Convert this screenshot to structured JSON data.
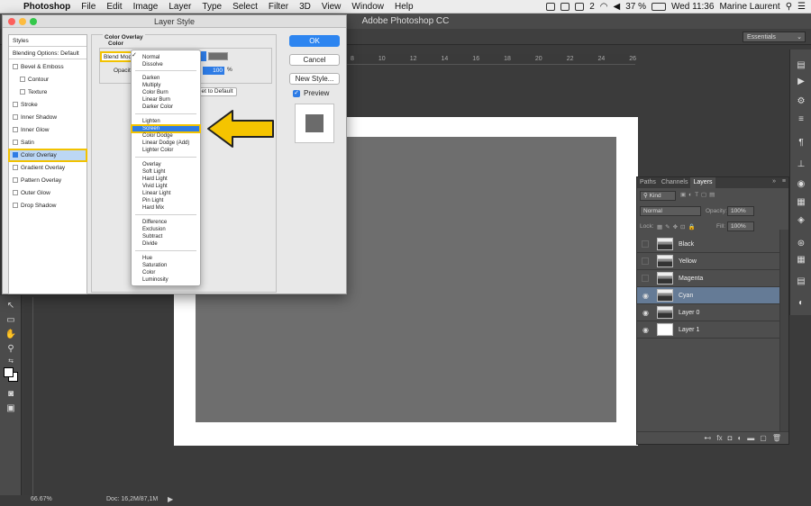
{
  "menubar": {
    "app_name": "Photoshop",
    "menus": [
      "File",
      "Edit",
      "Image",
      "Layer",
      "Type",
      "Select",
      "Filter",
      "3D",
      "View",
      "Window",
      "Help"
    ],
    "battery": "37 %",
    "notif_count": "2",
    "clock": "Wed 11:36",
    "user": "Marine Laurent"
  },
  "app": {
    "title": "Adobe Photoshop CC",
    "workspace": "Essentials",
    "zoom": "66.67%",
    "doc_size": "Doc: 16,2M/87,1M"
  },
  "ruler": {
    "ticks": [
      "8",
      "10",
      "12",
      "14",
      "16",
      "18",
      "20",
      "22",
      "24",
      "26"
    ]
  },
  "dialog": {
    "title": "Layer Style",
    "styles_header": "Styles",
    "blending_options": "Blending Options: Default",
    "styles": [
      {
        "label": "Bevel & Emboss",
        "checked": false
      },
      {
        "label": "Contour",
        "checked": false
      },
      {
        "label": "Texture",
        "checked": false
      },
      {
        "label": "Stroke",
        "checked": false
      },
      {
        "label": "Inner Shadow",
        "checked": false
      },
      {
        "label": "Inner Glow",
        "checked": false
      },
      {
        "label": "Satin",
        "checked": false
      },
      {
        "label": "Color Overlay",
        "checked": true
      },
      {
        "label": "Gradient Overlay",
        "checked": false
      },
      {
        "label": "Pattern Overlay",
        "checked": false
      },
      {
        "label": "Outer Glow",
        "checked": false
      },
      {
        "label": "Drop Shadow",
        "checked": false
      }
    ],
    "group_title": "Color Overlay",
    "subgroup_title": "Color",
    "blend_mode_label": "Blend Mode",
    "opacity_label": "Opacity",
    "opacity_value": "100",
    "opacity_unit": "%",
    "reset_label": "et to Default",
    "ok": "OK",
    "cancel": "Cancel",
    "new_style": "New Style...",
    "preview": "Preview",
    "overlay_color": "#6e6e6e"
  },
  "dropdown": {
    "selected": "Screen",
    "groups": [
      [
        "Normal",
        "Dissolve"
      ],
      [
        "Darken",
        "Multiply",
        "Color Burn",
        "Linear Burn",
        "Darker Color"
      ],
      [
        "Lighten",
        "Screen",
        "Color Dodge",
        "Linear Dodge (Add)",
        "Lighter Color"
      ],
      [
        "Overlay",
        "Soft Light",
        "Hard Light",
        "Vivid Light",
        "Linear Light",
        "Pin Light",
        "Hard Mix"
      ],
      [
        "Difference",
        "Exclusion",
        "Subtract",
        "Divide"
      ],
      [
        "Hue",
        "Saturation",
        "Color",
        "Luminosity"
      ]
    ]
  },
  "layers_panel": {
    "tabs": [
      "Paths",
      "Channels",
      "Layers"
    ],
    "active_tab": "Layers",
    "filter_kind": "Kind",
    "blend_mode": "Normal",
    "opacity_label": "Opacity:",
    "opacity_value": "100%",
    "lock_label": "Lock:",
    "fill_label": "Fill:",
    "fill_value": "100%",
    "layers": [
      {
        "name": "Black",
        "visible": false,
        "selected": false,
        "thumb": "img"
      },
      {
        "name": "Yellow",
        "visible": false,
        "selected": false,
        "thumb": "img"
      },
      {
        "name": "Magenta",
        "visible": false,
        "selected": false,
        "thumb": "img"
      },
      {
        "name": "Cyan",
        "visible": true,
        "selected": true,
        "thumb": "img"
      },
      {
        "name": "Layer 0",
        "visible": true,
        "selected": false,
        "thumb": "img"
      },
      {
        "name": "Layer 1",
        "visible": true,
        "selected": false,
        "thumb": "white"
      }
    ]
  },
  "colors": {
    "accent": "#2d7be5",
    "highlight": "#f2c200",
    "selected_layer": "#657b96"
  }
}
